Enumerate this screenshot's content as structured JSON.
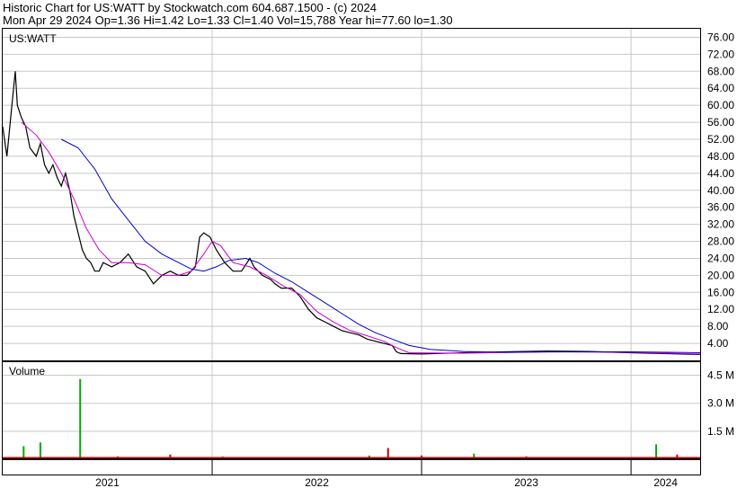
{
  "header": {
    "line1": "Historic Chart for US:WATT by Stockwatch.com 604.687.1500 - (c) 2024",
    "line2": "Mon Apr 29 2024  Op=1.36  Hi=1.42  Lo=1.33  Cl=1.40  Vol=15,788  Year hi=77.60  lo=1.30"
  },
  "colors": {
    "price": "#000000",
    "ma_short": "#cc00cc",
    "ma_long": "#0000cc",
    "volume_up": "#00aa00",
    "volume_down": "#cc0000",
    "grid": "#c8c8c8"
  },
  "chart_data": [
    {
      "type": "line",
      "title": "US:WATT",
      "ylim": [
        0,
        78
      ],
      "y_ticks": [
        {
          "value": 76,
          "label": "76.00"
        },
        {
          "value": 72,
          "label": "72.00"
        },
        {
          "value": 68,
          "label": "68.00"
        },
        {
          "value": 64,
          "label": "64.00"
        },
        {
          "value": 60,
          "label": "60.00"
        },
        {
          "value": 56,
          "label": "56.00"
        },
        {
          "value": 52,
          "label": "52.00"
        },
        {
          "value": 48,
          "label": "48.00"
        },
        {
          "value": 44,
          "label": "44.00"
        },
        {
          "value": 40,
          "label": "40.00"
        },
        {
          "value": 36,
          "label": "36.00"
        },
        {
          "value": 32,
          "label": "32.00"
        },
        {
          "value": 28,
          "label": "28.00"
        },
        {
          "value": 24,
          "label": "24.00"
        },
        {
          "value": 20,
          "label": "20.00"
        },
        {
          "value": 16,
          "label": "16.00"
        },
        {
          "value": 12,
          "label": "12.00"
        },
        {
          "value": 8,
          "label": "8.00"
        },
        {
          "value": 4,
          "label": "4.00"
        }
      ],
      "x_ticks": [
        "2021",
        "2022",
        "2023",
        "2024"
      ],
      "year_start": 2021.0,
      "year_end": 2024.33,
      "series": [
        {
          "role": "price",
          "points": [
            [
              2021.0,
              55
            ],
            [
              2021.02,
              48
            ],
            [
              2021.04,
              58
            ],
            [
              2021.06,
              68
            ],
            [
              2021.07,
              60
            ],
            [
              2021.09,
              57
            ],
            [
              2021.11,
              55
            ],
            [
              2021.13,
              50
            ],
            [
              2021.16,
              48
            ],
            [
              2021.18,
              51
            ],
            [
              2021.2,
              46
            ],
            [
              2021.22,
              44
            ],
            [
              2021.24,
              46
            ],
            [
              2021.26,
              43
            ],
            [
              2021.28,
              41
            ],
            [
              2021.3,
              44
            ],
            [
              2021.32,
              40
            ],
            [
              2021.34,
              34
            ],
            [
              2021.36,
              30
            ],
            [
              2021.38,
              26
            ],
            [
              2021.4,
              24
            ],
            [
              2021.42,
              23
            ],
            [
              2021.44,
              21
            ],
            [
              2021.46,
              21
            ],
            [
              2021.48,
              23
            ],
            [
              2021.52,
              22
            ],
            [
              2021.56,
              23
            ],
            [
              2021.6,
              25
            ],
            [
              2021.64,
              22
            ],
            [
              2021.68,
              21
            ],
            [
              2021.72,
              18
            ],
            [
              2021.76,
              20
            ],
            [
              2021.8,
              21
            ],
            [
              2021.84,
              20
            ],
            [
              2021.88,
              20
            ],
            [
              2021.92,
              22
            ],
            [
              2021.94,
              29
            ],
            [
              2021.96,
              30
            ],
            [
              2021.99,
              29
            ],
            [
              2022.02,
              26
            ],
            [
              2022.06,
              23
            ],
            [
              2022.1,
              21
            ],
            [
              2022.14,
              21
            ],
            [
              2022.18,
              24
            ],
            [
              2022.2,
              22
            ],
            [
              2022.24,
              20
            ],
            [
              2022.28,
              19
            ],
            [
              2022.3,
              18
            ],
            [
              2022.33,
              17
            ],
            [
              2022.38,
              17
            ],
            [
              2022.42,
              15
            ],
            [
              2022.46,
              12
            ],
            [
              2022.5,
              10
            ],
            [
              2022.54,
              9
            ],
            [
              2022.58,
              8
            ],
            [
              2022.62,
              7
            ],
            [
              2022.66,
              6.5
            ],
            [
              2022.7,
              6
            ],
            [
              2022.74,
              5
            ],
            [
              2022.78,
              4.5
            ],
            [
              2022.82,
              4
            ],
            [
              2022.86,
              3.5
            ],
            [
              2022.88,
              2
            ],
            [
              2022.9,
              1.6
            ],
            [
              2023.0,
              1.5
            ],
            [
              2023.2,
              1.8
            ],
            [
              2023.4,
              2.0
            ],
            [
              2023.6,
              2.2
            ],
            [
              2023.8,
              2.1
            ],
            [
              2024.0,
              1.8
            ],
            [
              2024.15,
              1.6
            ],
            [
              2024.33,
              1.4
            ]
          ]
        },
        {
          "role": "ma_short",
          "points": [
            [
              2021.09,
              56
            ],
            [
              2021.16,
              53
            ],
            [
              2021.22,
              49
            ],
            [
              2021.28,
              44
            ],
            [
              2021.34,
              38
            ],
            [
              2021.4,
              31
            ],
            [
              2021.46,
              26
            ],
            [
              2021.52,
              23
            ],
            [
              2021.6,
              23
            ],
            [
              2021.68,
              22.5
            ],
            [
              2021.76,
              20
            ],
            [
              2021.84,
              20
            ],
            [
              2021.9,
              21
            ],
            [
              2021.96,
              25
            ],
            [
              2022.0,
              28
            ],
            [
              2022.04,
              27
            ],
            [
              2022.1,
              23
            ],
            [
              2022.18,
              22
            ],
            [
              2022.26,
              20
            ],
            [
              2022.34,
              17.5
            ],
            [
              2022.42,
              15.5
            ],
            [
              2022.5,
              11.5
            ],
            [
              2022.58,
              9
            ],
            [
              2022.66,
              7
            ],
            [
              2022.74,
              5.8
            ],
            [
              2022.82,
              4.5
            ],
            [
              2022.88,
              3
            ],
            [
              2022.94,
              1.8
            ],
            [
              2023.2,
              1.7
            ],
            [
              2023.6,
              2.0
            ],
            [
              2024.0,
              1.9
            ],
            [
              2024.33,
              1.5
            ]
          ]
        },
        {
          "role": "ma_long",
          "points": [
            [
              2021.28,
              52
            ],
            [
              2021.36,
              50
            ],
            [
              2021.44,
              45
            ],
            [
              2021.52,
              38
            ],
            [
              2021.6,
              33
            ],
            [
              2021.68,
              28
            ],
            [
              2021.76,
              25
            ],
            [
              2021.84,
              23
            ],
            [
              2021.9,
              21.5
            ],
            [
              2021.96,
              21
            ],
            [
              2022.02,
              22
            ],
            [
              2022.08,
              23.5
            ],
            [
              2022.16,
              24
            ],
            [
              2022.22,
              23
            ],
            [
              2022.3,
              20.5
            ],
            [
              2022.38,
              18.5
            ],
            [
              2022.46,
              16
            ],
            [
              2022.54,
              13.5
            ],
            [
              2022.62,
              11
            ],
            [
              2022.7,
              8.5
            ],
            [
              2022.78,
              6.5
            ],
            [
              2022.86,
              5
            ],
            [
              2022.94,
              3.5
            ],
            [
              2023.04,
              2.6
            ],
            [
              2023.2,
              2.1
            ],
            [
              2023.4,
              1.9
            ],
            [
              2023.7,
              2.0
            ],
            [
              2024.0,
              2.0
            ],
            [
              2024.33,
              1.8
            ]
          ]
        }
      ]
    },
    {
      "type": "bar",
      "title": "Volume",
      "ylim": [
        0,
        5.2
      ],
      "y_ticks": [
        {
          "value": 4.5,
          "label": "4.5 M"
        },
        {
          "value": 3.0,
          "label": "3.0 M"
        },
        {
          "value": 1.5,
          "label": "1.5 M"
        }
      ],
      "bars": [
        {
          "x": 2021.1,
          "value": 0.7,
          "up": true
        },
        {
          "x": 2021.18,
          "value": 0.9,
          "up": true
        },
        {
          "x": 2021.37,
          "value": 4.3,
          "up": true
        },
        {
          "x": 2021.55,
          "value": 0.15,
          "up": false
        },
        {
          "x": 2021.8,
          "value": 0.25,
          "up": false
        },
        {
          "x": 2022.05,
          "value": 0.15,
          "up": true
        },
        {
          "x": 2022.5,
          "value": 0.12,
          "up": false
        },
        {
          "x": 2022.75,
          "value": 0.2,
          "up": true
        },
        {
          "x": 2022.84,
          "value": 0.6,
          "up": false
        },
        {
          "x": 2023.0,
          "value": 0.2,
          "up": false
        },
        {
          "x": 2023.25,
          "value": 0.3,
          "up": true
        },
        {
          "x": 2023.5,
          "value": 0.15,
          "up": false
        },
        {
          "x": 2024.12,
          "value": 0.8,
          "up": true
        },
        {
          "x": 2024.22,
          "value": 0.25,
          "up": false
        }
      ]
    }
  ]
}
